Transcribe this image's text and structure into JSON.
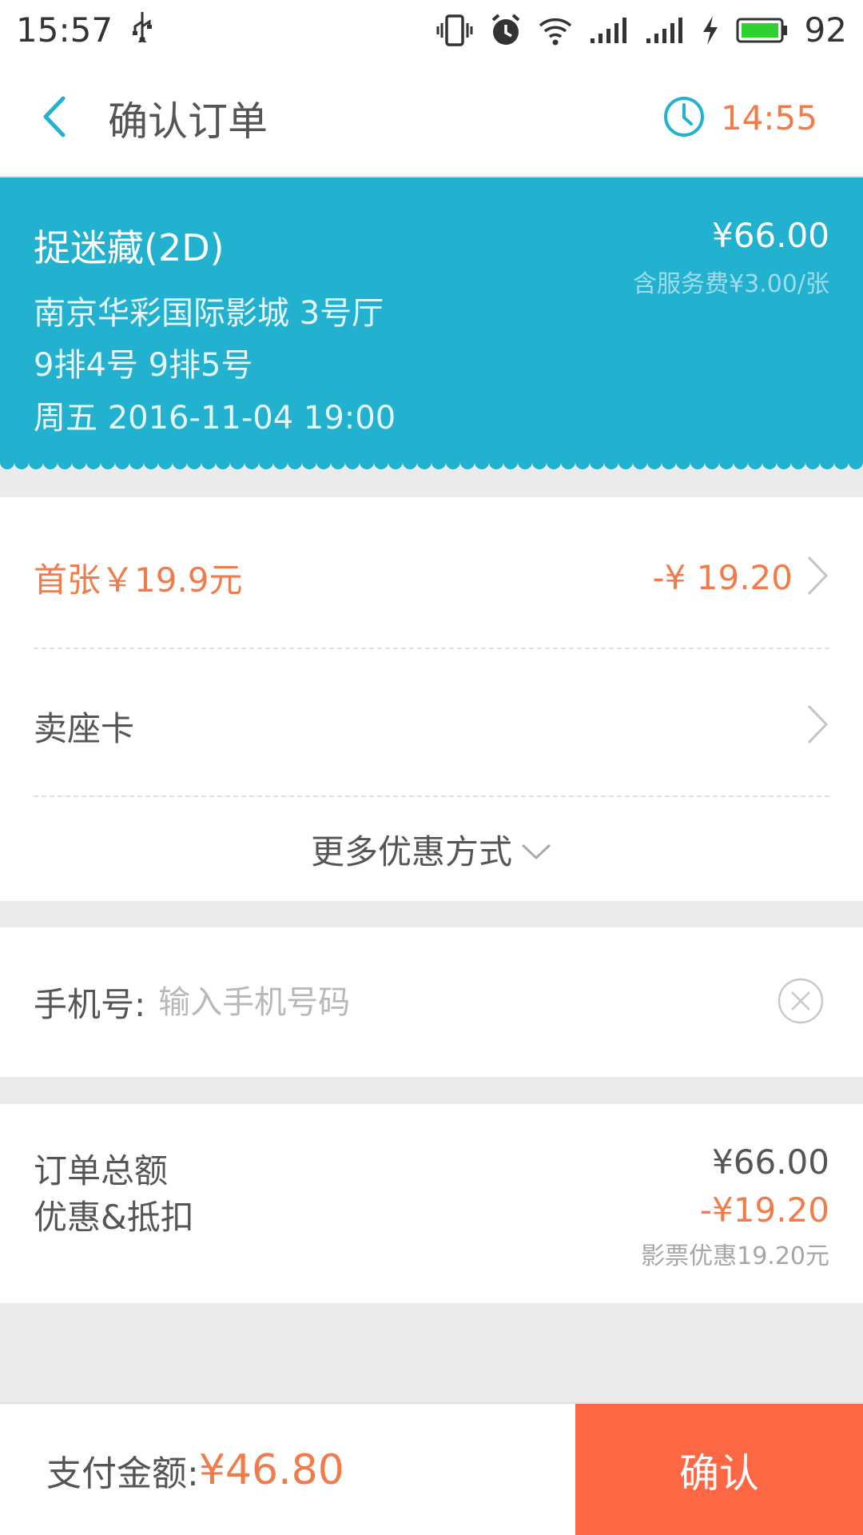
{
  "status_bar": {
    "time": "15:57",
    "battery": "92",
    "icons": [
      "usb-icon",
      "vibrate-icon",
      "alarm-icon",
      "wifi-icon",
      "signal-icon",
      "signal-icon",
      "charging-icon",
      "battery-icon"
    ]
  },
  "header": {
    "title": "确认订单",
    "countdown": "14:55"
  },
  "ticket": {
    "movie": "捉迷藏(2D)",
    "cinema": "南京华彩国际影城  3号厅",
    "seats": "9排4号   9排5号",
    "showtime": "周五 2016-11-04 19:00",
    "price": "¥66.00",
    "service_fee": "含服务费¥3.00/张"
  },
  "discounts": {
    "first_ticket_label": "首张￥19.9元",
    "first_ticket_amount": "-¥ 19.20",
    "seat_card_label": "卖座卡",
    "more_label": "更多优惠方式"
  },
  "phone": {
    "label": "手机号:",
    "placeholder": "输入手机号码",
    "value": ""
  },
  "summary": {
    "total_label": "订单总额",
    "discount_label": "优惠&抵扣",
    "total_value": "¥66.00",
    "discount_value": "-¥19.20",
    "discount_note": "影票优惠19.20元"
  },
  "footer": {
    "pay_label": "支付金额:",
    "pay_amount": "¥46.80",
    "confirm_label": "确认"
  },
  "colors": {
    "accent_blue": "#22b2d0",
    "accent_orange": "#f07c4c",
    "confirm_button": "#fd6744"
  }
}
